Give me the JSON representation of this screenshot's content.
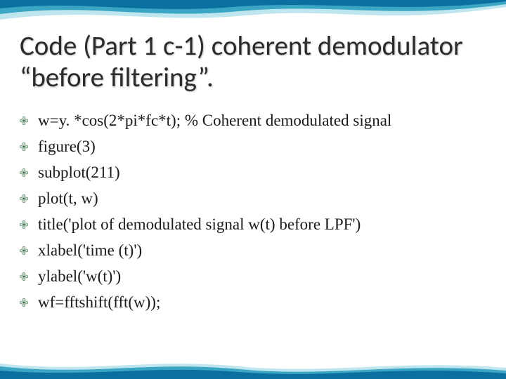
{
  "title": "Code (Part 1 c-1) coherent demodulator “before filtering”.",
  "bullets": [
    "w=y. *cos(2*pi*fc*t);            % Coherent demodulated signal",
    "figure(3)",
    "subplot(211)",
    "plot(t, w)",
    "title('plot of demodulated signal w(t) before LPF')",
    "xlabel('time (t)')",
    "ylabel('w(t)')",
    "wf=fftshift(fft(w));"
  ],
  "colors": {
    "swoosh_dark": "#0b6fa0",
    "swoosh_mid": "#3aa6c4",
    "swoosh_light": "#bfe6ee",
    "bullet_fill": "#cfe3d3",
    "bullet_stroke": "#3b6a4a"
  }
}
